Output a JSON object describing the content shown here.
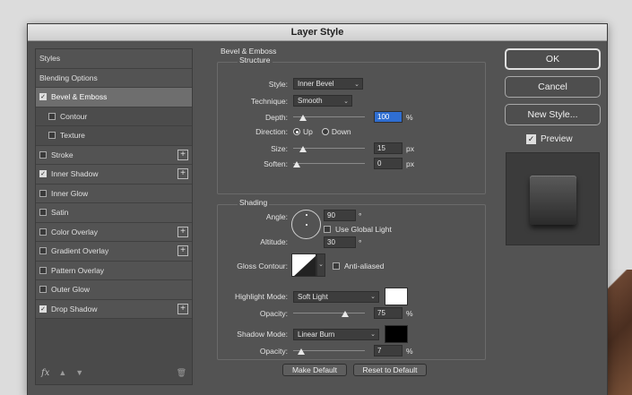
{
  "window": {
    "title": "Layer Style"
  },
  "left_panel": {
    "items": [
      {
        "label": "Styles",
        "checkbox": false,
        "checked": false,
        "plus": false
      },
      {
        "label": "Blending Options",
        "checkbox": false,
        "checked": false,
        "plus": false
      },
      {
        "label": "Bevel & Emboss",
        "checkbox": true,
        "checked": true,
        "plus": false,
        "active": true
      },
      {
        "label": "Contour",
        "checkbox": true,
        "checked": false,
        "plus": false,
        "sub": true
      },
      {
        "label": "Texture",
        "checkbox": true,
        "checked": false,
        "plus": false,
        "sub": true
      },
      {
        "label": "Stroke",
        "checkbox": true,
        "checked": false,
        "plus": true
      },
      {
        "label": "Inner Shadow",
        "checkbox": true,
        "checked": true,
        "plus": true
      },
      {
        "label": "Inner Glow",
        "checkbox": true,
        "checked": false,
        "plus": false
      },
      {
        "label": "Satin",
        "checkbox": true,
        "checked": false,
        "plus": false
      },
      {
        "label": "Color Overlay",
        "checkbox": true,
        "checked": false,
        "plus": true
      },
      {
        "label": "Gradient Overlay",
        "checkbox": true,
        "checked": false,
        "plus": true
      },
      {
        "label": "Pattern Overlay",
        "checkbox": true,
        "checked": false,
        "plus": false
      },
      {
        "label": "Outer Glow",
        "checkbox": true,
        "checked": false,
        "plus": false
      },
      {
        "label": "Drop Shadow",
        "checkbox": true,
        "checked": true,
        "plus": true
      }
    ],
    "footer": {
      "fx": "fx"
    }
  },
  "bevel": {
    "title": "Bevel & Emboss",
    "structure_title": "Structure",
    "style_label": "Style:",
    "style_value": "Inner Bevel",
    "technique_label": "Technique:",
    "technique_value": "Smooth",
    "depth_label": "Depth:",
    "depth_value": "100",
    "depth_unit": "%",
    "depth_level": 0.1,
    "direction_label": "Direction:",
    "direction_up": "Up",
    "direction_down": "Down",
    "size_label": "Size:",
    "size_value": "15",
    "size_unit": "px",
    "size_level": 0.1,
    "soften_label": "Soften:",
    "soften_value": "0",
    "soften_unit": "px",
    "soften_level": 0.0
  },
  "shading": {
    "title": "Shading",
    "angle_label": "Angle:",
    "angle_value": "90",
    "angle_unit": "°",
    "global_light_label": "Use Global Light",
    "altitude_label": "Altitude:",
    "altitude_value": "30",
    "altitude_unit": "°",
    "gloss_label": "Gloss Contour:",
    "anti_aliased_label": "Anti-aliased",
    "highlight_mode_label": "Highlight Mode:",
    "highlight_mode_value": "Soft Light",
    "highlight_color": "#ffffff",
    "highlight_opacity_label": "Opacity:",
    "highlight_opacity_value": "75",
    "highlight_opacity_unit": "%",
    "highlight_level": 0.75,
    "shadow_mode_label": "Shadow Mode:",
    "shadow_mode_value": "Linear Burn",
    "shadow_color": "#000000",
    "shadow_opacity_label": "Opacity:",
    "shadow_opacity_value": "7",
    "shadow_opacity_unit": "%",
    "shadow_level": 0.07
  },
  "buttons": {
    "make_default": "Make Default",
    "reset_default": "Reset to Default",
    "ok": "OK",
    "cancel": "Cancel",
    "new_style": "New Style...",
    "preview": "Preview"
  }
}
